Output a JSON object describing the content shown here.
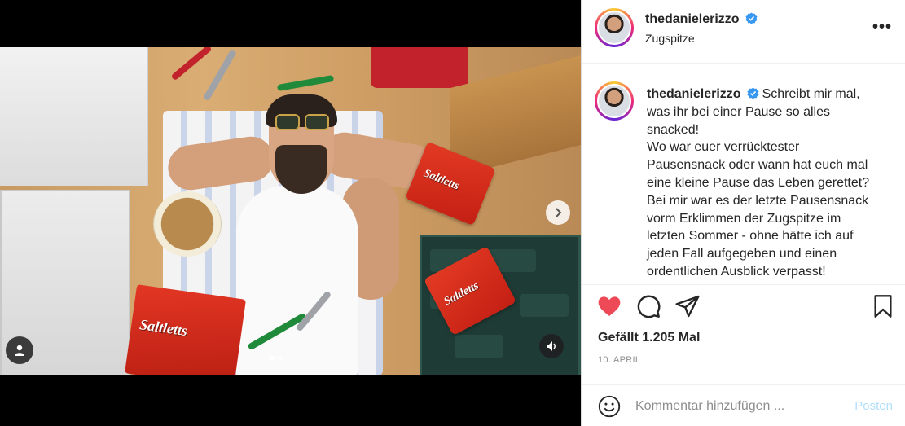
{
  "post": {
    "username": "thedanielerizzo",
    "location": "Zugspitze",
    "caption_lines": [
      "Schreibt mir mal,",
      "was ihr bei einer Pause so alles",
      "snacked!",
      "Wo war euer verrücktester",
      "Pausensnack oder wann hat euch mal",
      "eine kleine Pause das Leben gerettet?",
      "Bei mir war es der letzte Pausensnack",
      "vorm Erklimmen der Zugspitze im",
      "letzten Sommer - ohne hätte ich auf",
      "jeden Fall aufgegeben und einen",
      "ordentlichen Ausblick verpasst!"
    ],
    "likes_text": "Gefällt 1.205 Mal",
    "date": "10. APRIL"
  },
  "media": {
    "product_label": "Saltletts",
    "carousel_total": 2,
    "carousel_active": 1,
    "icons": [
      "chevron-right-icon",
      "user-tag-icon",
      "sound-icon"
    ]
  },
  "comment": {
    "placeholder": "Kommentar hinzufügen ...",
    "post_label": "Posten"
  },
  "colors": {
    "like": "#ed4956",
    "verified": "#3897f0",
    "post_disabled": "#b2dffc",
    "muted": "#8e8e8e"
  }
}
